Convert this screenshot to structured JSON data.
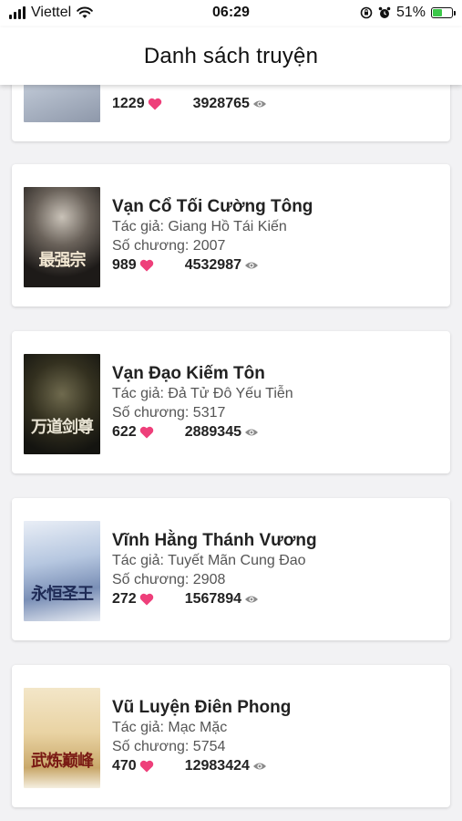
{
  "status_bar": {
    "carrier": "Viettel",
    "time": "06:29",
    "battery": "51%",
    "battery_level": 0.51
  },
  "header": {
    "title": "Danh sách truyện"
  },
  "books": [
    {
      "title": "",
      "author": "",
      "chapters": "",
      "likes": "1229",
      "views": "3928765",
      "cover_text": ""
    },
    {
      "title": "Vạn Cổ Tối Cường Tông",
      "author": "Tác giả: Giang Hồ Tái Kiến",
      "chapters": "Số chương: 2007",
      "likes": "989",
      "views": "4532987",
      "cover_text": "最强宗"
    },
    {
      "title": "Vạn Đạo Kiếm Tôn",
      "author": "Tác giả: Đả Tử Đô Yếu Tiễn",
      "chapters": "Số chương: 5317",
      "likes": "622",
      "views": "2889345",
      "cover_text": "万道剑尊"
    },
    {
      "title": "Vĩnh Hằng Thánh Vương",
      "author": "Tác giả: Tuyết Mãn Cung Đao",
      "chapters": "Số chương: 2908",
      "likes": "272",
      "views": "1567894",
      "cover_text": "永恒圣王"
    },
    {
      "title": "Vũ Luyện Điên Phong",
      "author": "Tác giả: Mạc Mặc",
      "chapters": "Số chương: 5754",
      "likes": "470",
      "views": "12983424",
      "cover_text": "武炼巅峰"
    }
  ],
  "colors": {
    "heart": "#ee3f7a",
    "eye": "#8a8a8a",
    "battery_fill": "#3cc84a"
  },
  "icons": [
    "signal-icon",
    "wifi-icon",
    "orientation-lock-icon",
    "alarm-icon",
    "battery-icon",
    "heart-icon",
    "eye-icon"
  ]
}
